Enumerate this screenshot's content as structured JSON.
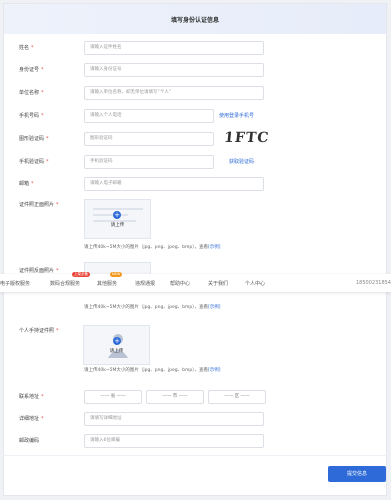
{
  "page": {
    "title": "填写身份认证信息"
  },
  "form": {
    "name": {
      "label": "姓名",
      "placeholder": "请输入证件姓名"
    },
    "id_number": {
      "label": "身份证号",
      "placeholder": "请输入身份证号"
    },
    "company": {
      "label": "单位名称",
      "placeholder": "请输入单位名称，如无单位请填写“个人”"
    },
    "phone": {
      "label": "手机号码",
      "placeholder": "请输入个人电话",
      "link": "使用登录手机号"
    },
    "captcha": {
      "label": "图形验证码",
      "placeholder": "图形验证码",
      "image_text": "1FTC"
    },
    "sms": {
      "label": "手机验证码",
      "placeholder": "手机验证码",
      "link": "获取验证码"
    },
    "email": {
      "label": "邮箱",
      "placeholder": "请输入电子邮箱"
    },
    "id_front": {
      "label": "证件照正面照片",
      "upload": "请上传",
      "hint": "请上传40k~5M大小的图片（jpg、png、jpeg、bmp），查看",
      "example": "[示例]"
    },
    "id_back": {
      "label": "证件照反面照片",
      "hint": "请上传40k~5M大小的图片（jpg、png、jpeg、bmp），查看",
      "example": "[示例]"
    },
    "handheld": {
      "label": "个人手持证件照",
      "upload": "请上传",
      "hint": "请上传40k~5M大小的图片（jpg、png、jpeg、bmp），查看",
      "example": "[示例]"
    },
    "address": {
      "label": "联系地址",
      "province": "—— 省 ——",
      "city": "—— 市 ——",
      "district": "—— 区 ——"
    },
    "detail_address": {
      "label": "详细地址",
      "placeholder": "请填写详细地址"
    },
    "postcode": {
      "label": "邮政编码",
      "placeholder": "请输入6位邮编"
    },
    "submit": "提交信息"
  },
  "nav": {
    "items": [
      "电子版权服务",
      "数码合规服务",
      "其他服务",
      "违规通报",
      "帮助中心",
      "关于我们",
      "个人中心"
    ],
    "badges": {
      "upgrade": "上架必备",
      "new": "NEW"
    },
    "phone": "18500231854",
    "colors": {
      "badge_red": "#e9473a",
      "badge_orange": "#f39a1e"
    }
  },
  "colors": {
    "accent": "#2e6bd8",
    "required": "#e34d4d"
  }
}
